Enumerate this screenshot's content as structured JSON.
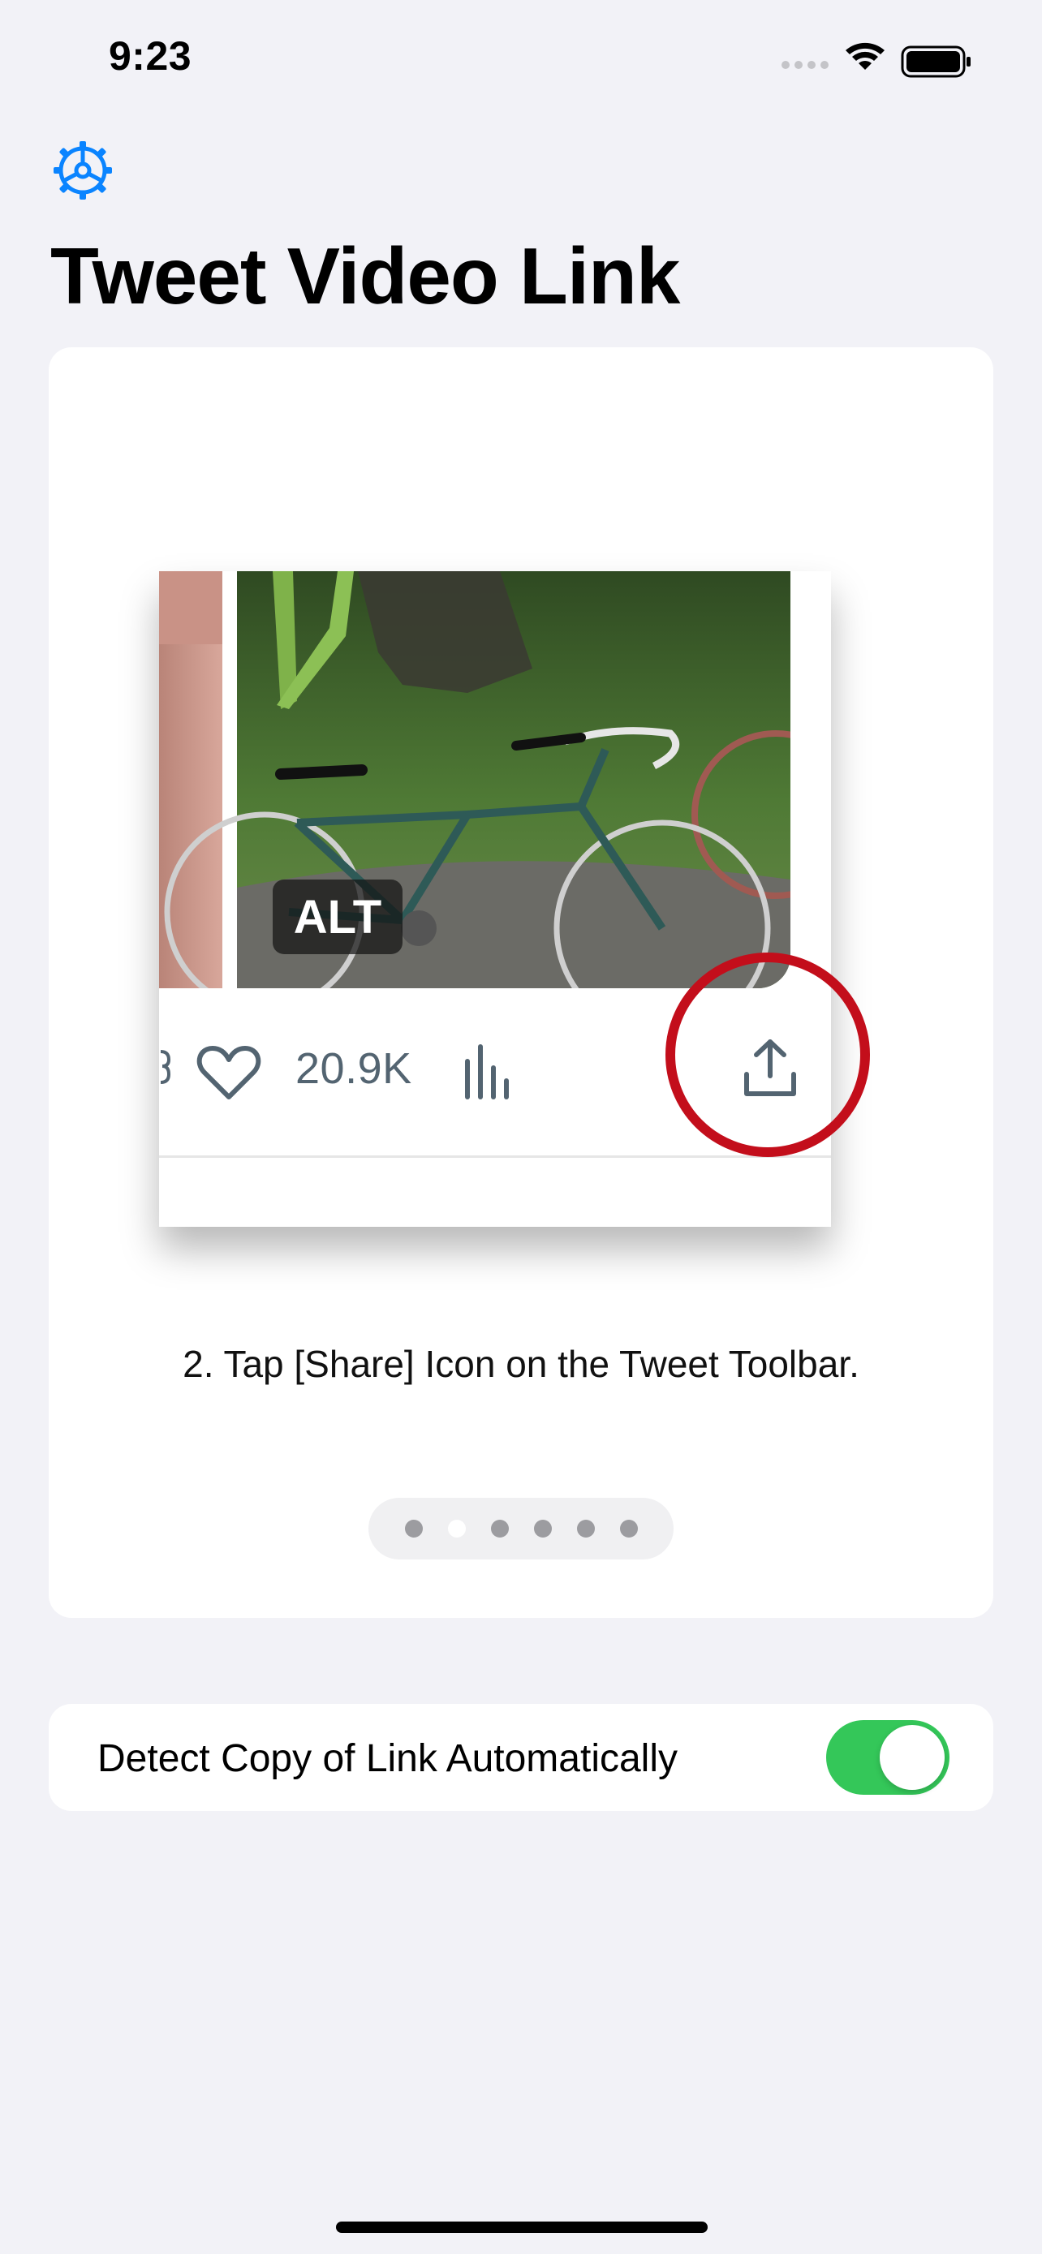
{
  "status_bar": {
    "time": "9:23"
  },
  "header": {
    "settings_icon": "gear-icon",
    "title": "Tweet Video Link"
  },
  "tutorial": {
    "illustration": {
      "alt_badge": "ALT",
      "like_count": "20.9K",
      "icons": [
        "heart-icon",
        "bar-chart-icon",
        "share-icon"
      ],
      "highlight_color": "#c30e1b"
    },
    "step_text": "2. Tap [Share] Icon on the Tweet Toolbar.",
    "page_indicator": {
      "total": 6,
      "current": 2
    }
  },
  "settings": {
    "detect_copy_label": "Detect Copy of Link Automatically",
    "detect_copy_enabled": true,
    "toggle_color": "#34c759"
  },
  "colors": {
    "accent": "#0a84ff",
    "background": "#f2f2f7"
  }
}
